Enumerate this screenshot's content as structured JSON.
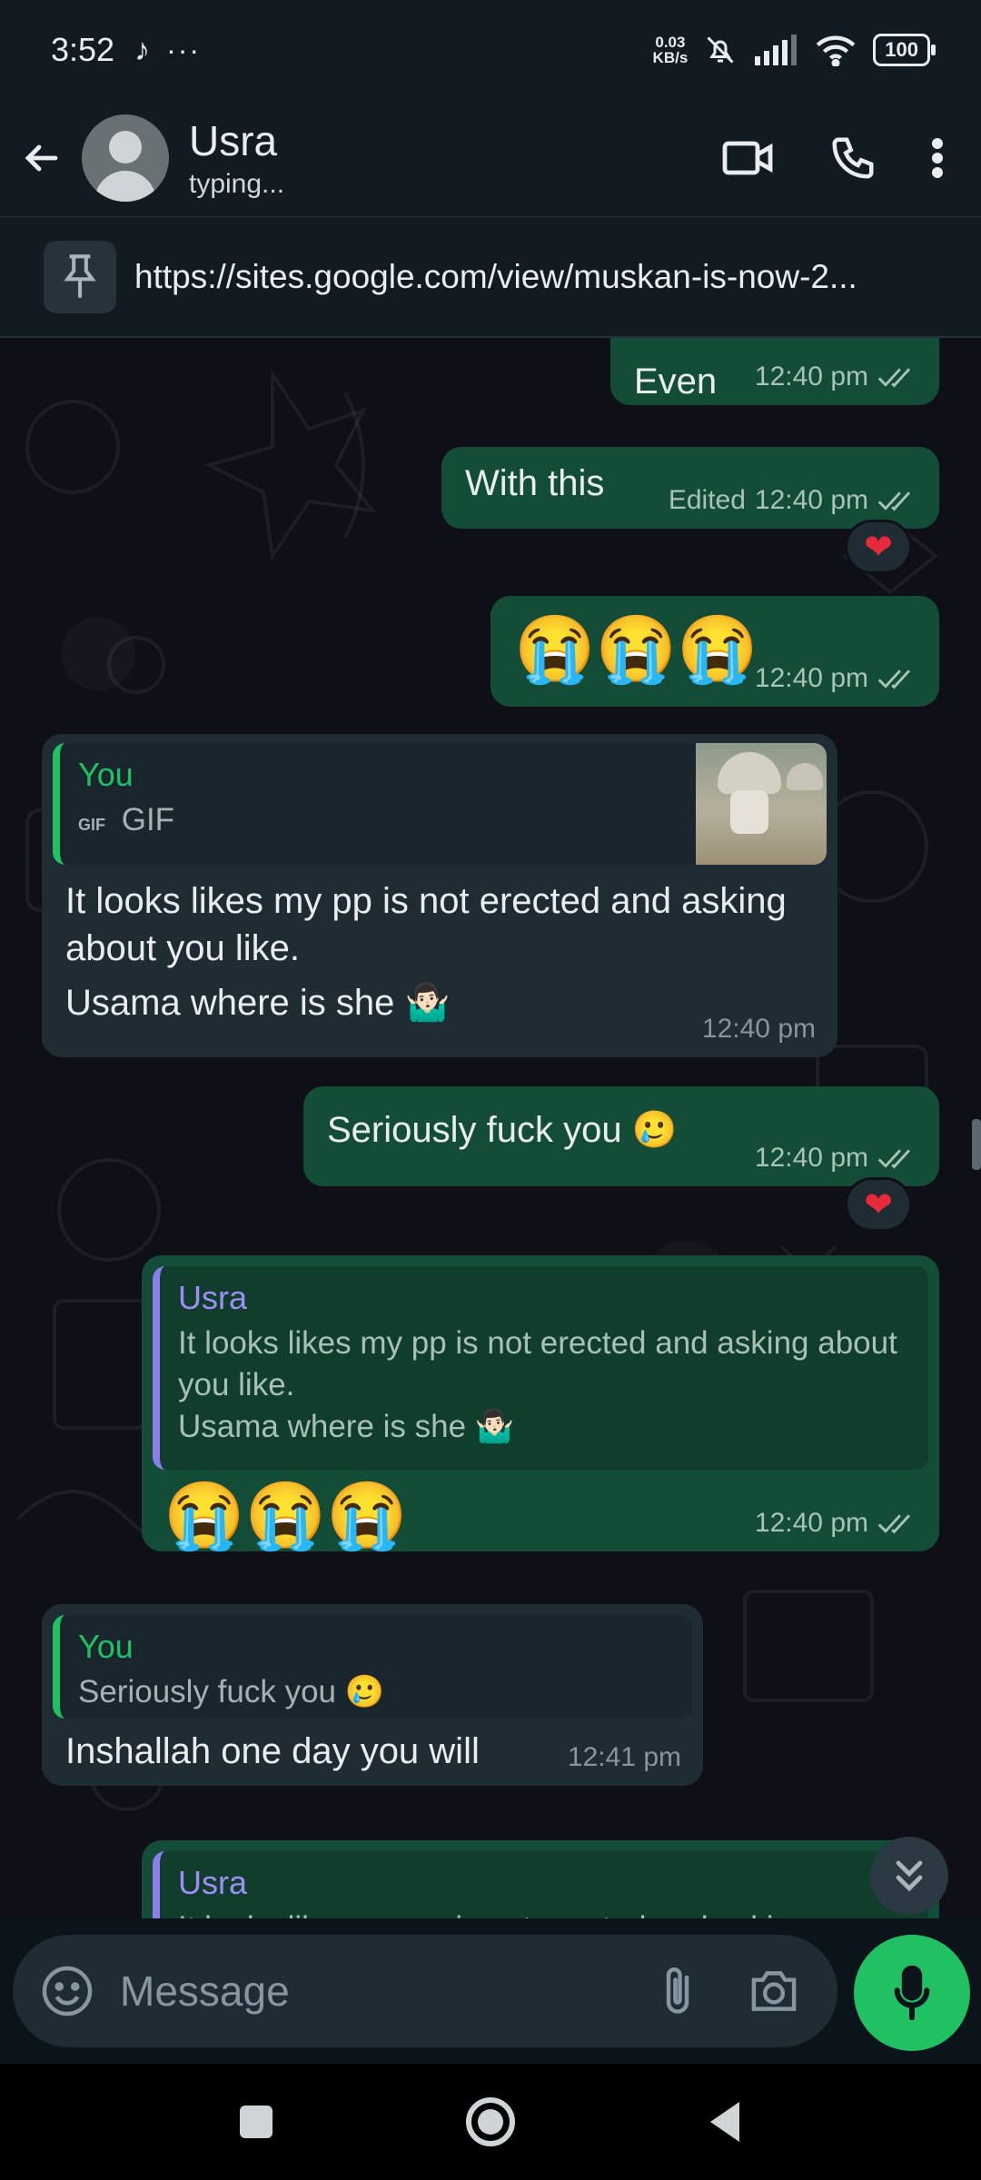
{
  "status": {
    "time": "3:52",
    "dots": "···",
    "net_speed_value": "0.03",
    "net_speed_unit": "KB/s",
    "battery": "100"
  },
  "header": {
    "contact_name": "Usra",
    "subtitle": "typing..."
  },
  "pinned": {
    "text": "https://sites.google.com/view/muskan-is-now-2..."
  },
  "messages": [
    {
      "id": "m1",
      "dir": "out",
      "text": "Even",
      "time": "12:40 pm"
    },
    {
      "id": "m2",
      "dir": "out",
      "text": "With this",
      "edited": "Edited",
      "time": "12:40 pm",
      "reaction": "❤"
    },
    {
      "id": "m3",
      "dir": "out",
      "text": "😭😭😭",
      "time": "12:40 pm"
    },
    {
      "id": "m4",
      "dir": "in",
      "quote_name": "You",
      "quote_label": "GIF",
      "quote_gif_badge": "GIF",
      "line1": "It looks likes my pp is not erected and asking about you like.",
      "line2": "Usama where is she",
      "line2_emoji": "🤷🏻‍♂️",
      "time": "12:40 pm"
    },
    {
      "id": "m5",
      "dir": "out",
      "text": "Seriously fuck you",
      "emoji": "🥲",
      "time": "12:40 pm",
      "reaction": "❤"
    },
    {
      "id": "m6",
      "dir": "out",
      "quote_name": "Usra",
      "quote_line1": "It looks likes my pp is not erected and asking about you like.",
      "quote_line2": "Usama where is she",
      "quote_emoji": "🤷🏻‍♂️",
      "text": "😭😭😭",
      "time": "12:40 pm"
    },
    {
      "id": "m7",
      "dir": "in",
      "quote_name": "You",
      "quote_text": "Seriously fuck you",
      "quote_emoji": "🥲",
      "text": "Inshallah one day you will",
      "time": "12:41 pm"
    },
    {
      "id": "m8",
      "dir": "out",
      "quote_name": "Usra",
      "quote_text": "It looks likes my pp is not erected and asking"
    }
  ],
  "composer": {
    "placeholder": "Message"
  },
  "colors": {
    "outgoing_bubble": "#144d37",
    "incoming_bubble": "#1f2c34",
    "accent_green": "#21c063",
    "quote_purple": "#9d8ff5",
    "heart_red": "#e62a3c"
  },
  "icons": [
    "back-arrow-icon",
    "video-call-icon",
    "phone-icon",
    "more-vert-icon",
    "pin-icon",
    "double-check-icon",
    "emoji-icon",
    "attach-icon",
    "camera-icon",
    "mic-icon",
    "chevrons-down-icon",
    "nav-recent-icon",
    "nav-home-icon",
    "nav-back-icon"
  ]
}
